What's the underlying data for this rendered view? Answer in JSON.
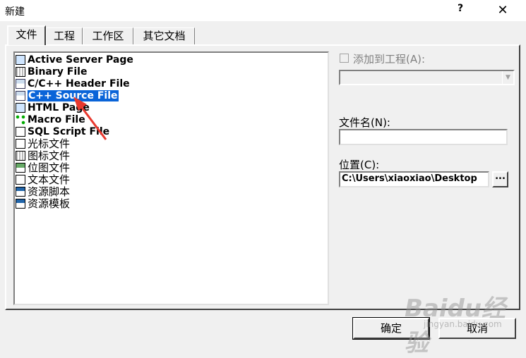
{
  "window": {
    "title": "新建",
    "help_label": "?",
    "close_label": "✕"
  },
  "tabs": [
    {
      "label": "文件",
      "active": true
    },
    {
      "label": "工程",
      "active": false
    },
    {
      "label": "工作区",
      "active": false
    },
    {
      "label": "其它文档",
      "active": false
    }
  ],
  "file_types": [
    {
      "label": "Active Server Page",
      "icon": "asp-file-icon"
    },
    {
      "label": "Binary File",
      "icon": "binary-file-icon"
    },
    {
      "label": "C/C++ Header File",
      "icon": "header-file-icon"
    },
    {
      "label": "C++ Source File",
      "icon": "cpp-source-file-icon",
      "selected": true
    },
    {
      "label": "HTML Page",
      "icon": "html-page-icon"
    },
    {
      "label": "Macro File",
      "icon": "macro-file-icon"
    },
    {
      "label": "SQL Script File",
      "icon": "sql-script-icon"
    },
    {
      "label": "光标文件",
      "icon": "cursor-file-icon"
    },
    {
      "label": "图标文件",
      "icon": "icon-file-icon"
    },
    {
      "label": "位图文件",
      "icon": "bitmap-file-icon"
    },
    {
      "label": "文本文件",
      "icon": "text-file-icon"
    },
    {
      "label": "资源脚本",
      "icon": "resource-script-icon"
    },
    {
      "label": "资源模板",
      "icon": "resource-template-icon"
    }
  ],
  "add_to_project": {
    "label": "添加到工程(A):",
    "checked": false,
    "enabled": false,
    "project_value": ""
  },
  "filename": {
    "label": "文件名(N):",
    "value": ""
  },
  "location": {
    "label": "位置(C):",
    "value": "C:\\Users\\xiaoxiao\\Desktop",
    "browse_label": "..."
  },
  "buttons": {
    "ok_label": "确定",
    "cancel_label": "取消"
  },
  "watermark": {
    "logo_text": "Baidu经验",
    "url": "jingyan.baidu.com"
  },
  "colors": {
    "selection": "#0a64d8",
    "annotation_arrow": "#e8392f"
  }
}
